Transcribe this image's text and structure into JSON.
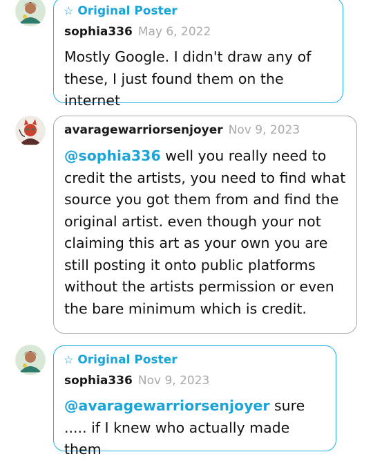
{
  "comments": [
    {
      "op_label": "Original Poster",
      "username": "sophia336",
      "date": "May 6, 2022",
      "text": "Mostly Google. I didn't draw any of these, I just found them on the internet"
    },
    {
      "username": "avaragewarriorsenjoyer",
      "date": "Nov 9, 2023",
      "mention": "@sophia336",
      "text": "well you really need to credit the artists, you need to find what source you got them from and find the original artist. even though your not claiming this art as your own you are still posting it onto public platforms without the artists permission or even the bare minimum which is credit."
    },
    {
      "op_label": "Original Poster",
      "username": "sophia336",
      "date": "Nov 9, 2023",
      "mention": "@avaragewarriorsenjoyer",
      "text": "sure ..... if I knew who actually made them"
    }
  ],
  "colors": {
    "accent": "#1aa4d8",
    "op_border": "#1ab0e6",
    "border": "#a9a9a9",
    "date": "#a9a9a9"
  },
  "icons": {
    "op": "star-outline-icon"
  }
}
